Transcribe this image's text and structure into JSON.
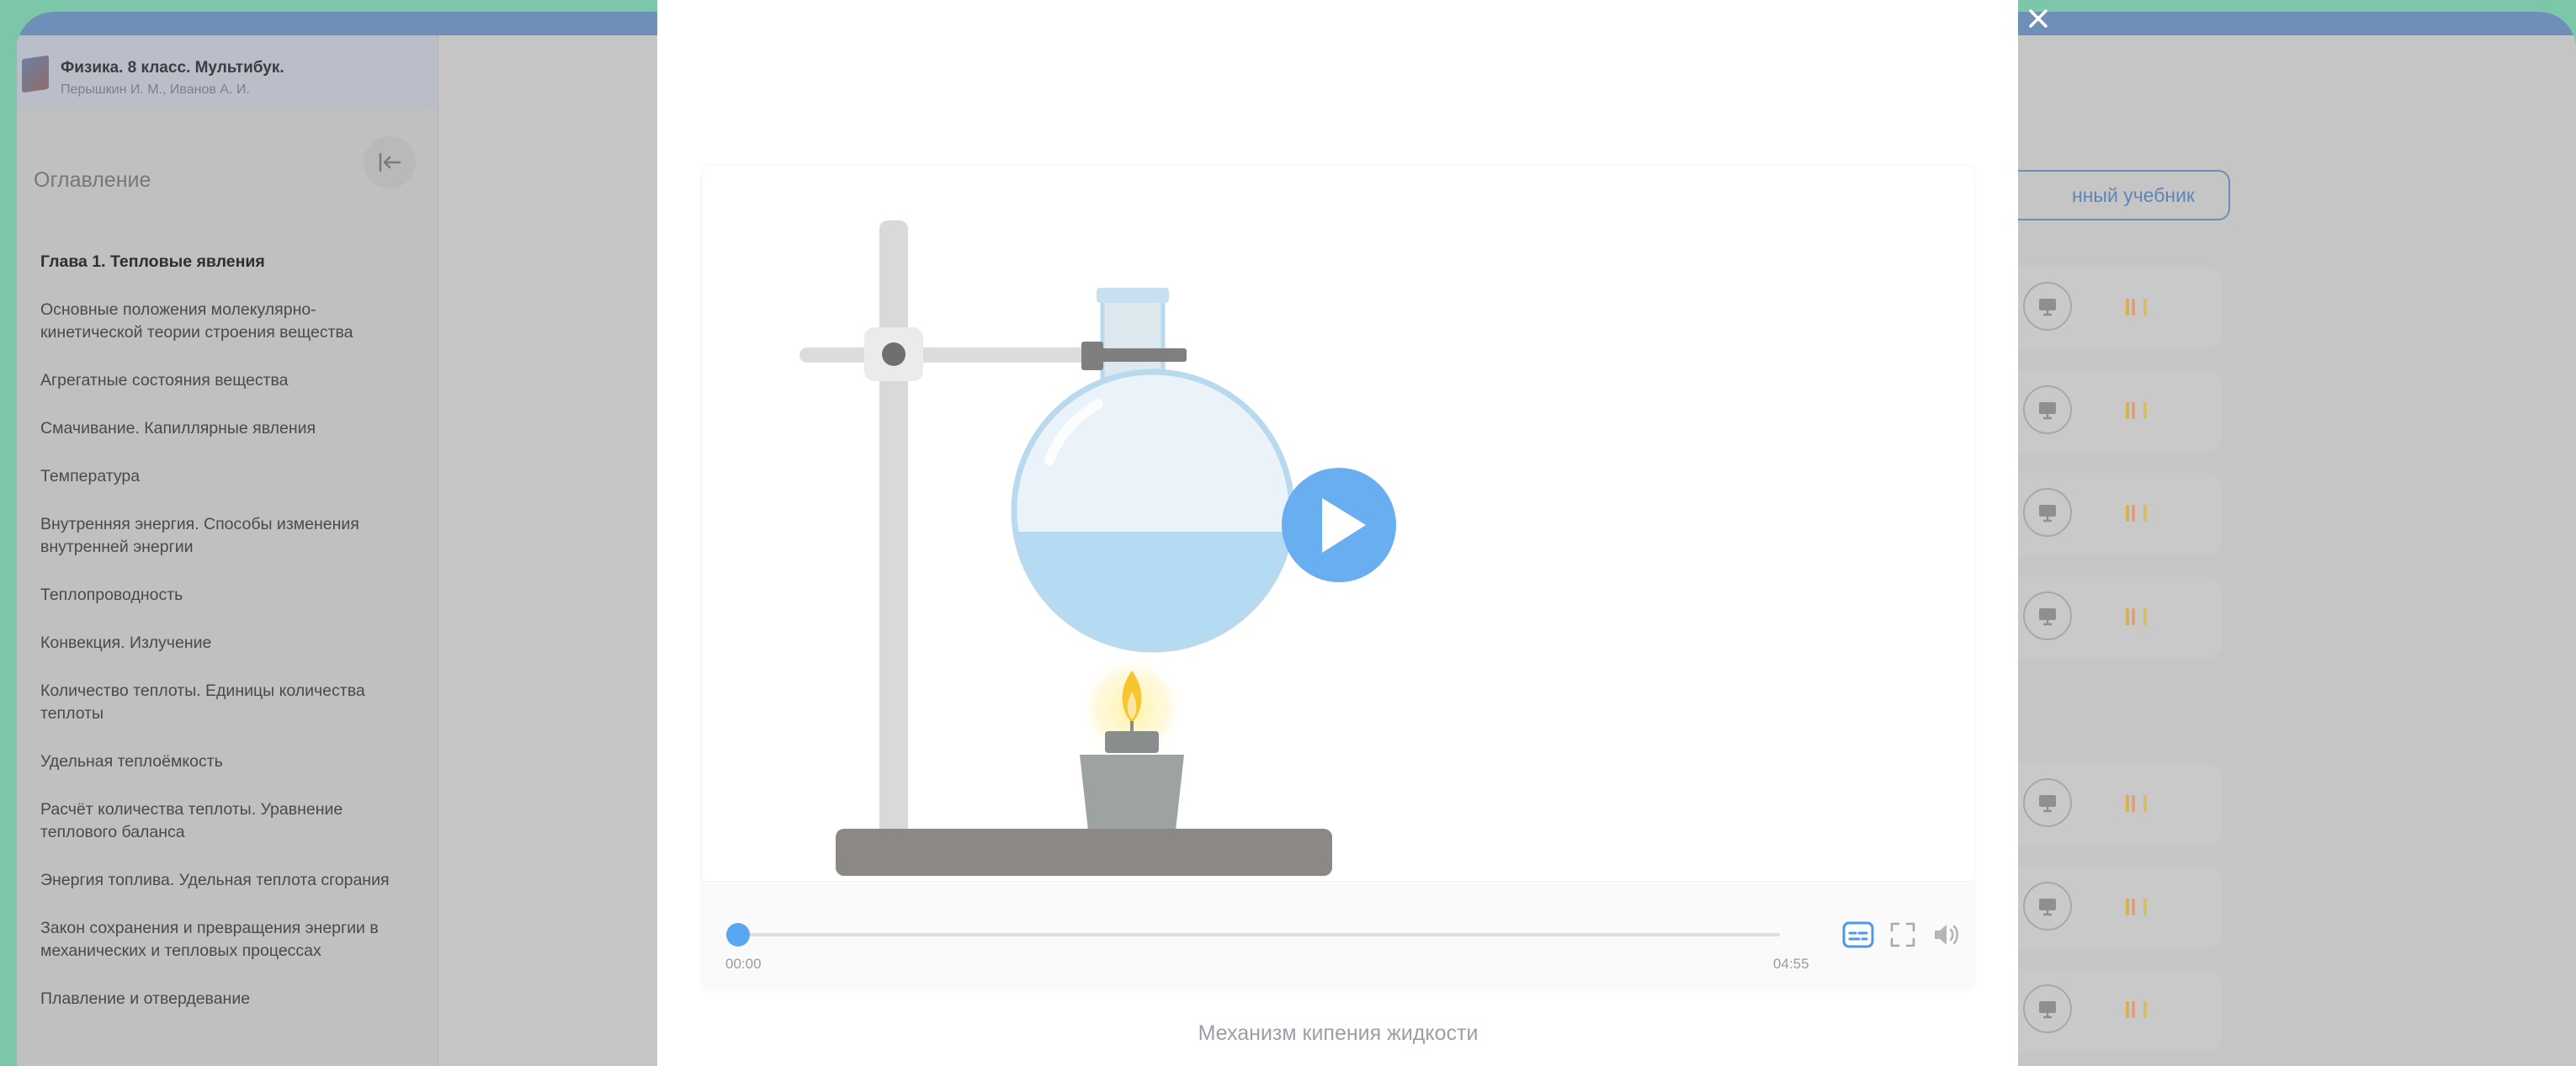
{
  "book": {
    "title": "Физика. 8 класс. Мультибук.",
    "authors": "Перышкин И. М., Иванов А. И."
  },
  "toc": {
    "title": "Оглавление",
    "items": [
      {
        "label": "Глава 1. Тепловые явления",
        "chapter": true
      },
      {
        "label": "Основные положения молекулярно-кинетической теории строения вещества",
        "chapter": false
      },
      {
        "label": "Агрегатные состояния вещества",
        "chapter": false
      },
      {
        "label": "Смачивание. Капиллярные явления",
        "chapter": false
      },
      {
        "label": "Температура",
        "chapter": false
      },
      {
        "label": "Внутренняя энергия. Способы изменения внутренней энергии",
        "chapter": false
      },
      {
        "label": "Теплопроводность",
        "chapter": false
      },
      {
        "label": "Конвекция. Излучение",
        "chapter": false
      },
      {
        "label": "Количество теплоты. Единицы количества теплоты",
        "chapter": false
      },
      {
        "label": "Удельная теплоёмкость",
        "chapter": false
      },
      {
        "label": "Расчёт количества теплоты. Уравнение теплового баланса",
        "chapter": false
      },
      {
        "label": "Энергия топлива. Удельная теплота сгорания",
        "chapter": false
      },
      {
        "label": "Закон сохранения и превращения энергии в механических и тепловых процессах",
        "chapter": false
      },
      {
        "label": "Плавление и отвердевание",
        "chapter": false
      }
    ]
  },
  "main": {
    "textbook_button": "нный учебник",
    "resource_count": 7
  },
  "player": {
    "current_time": "00:00",
    "duration": "04:55",
    "progress": 0,
    "caption": "Механизм кипения жидкости"
  },
  "icons": {
    "close": "close-icon",
    "play": "play-icon",
    "subtitles": "subtitles-icon",
    "fullscreen": "fullscreen-icon",
    "volume": "volume-icon",
    "collapse": "collapse-sidebar-icon"
  },
  "colors": {
    "accent": "#59a6f2",
    "background": "#7cc6a9",
    "overlay": "#c5c5c6",
    "topbar": "#6e8fb7"
  }
}
